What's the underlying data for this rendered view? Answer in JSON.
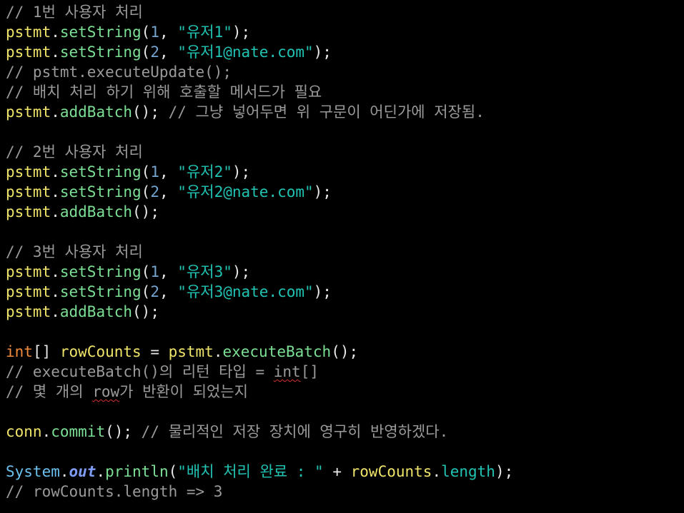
{
  "lines": [
    [
      {
        "t": "// 1번 사용자 처리",
        "c": "cm"
      }
    ],
    [
      {
        "t": "pstmt",
        "c": "var"
      },
      {
        "t": ".",
        "c": "pun"
      },
      {
        "t": "setString",
        "c": "fn"
      },
      {
        "t": "(",
        "c": "pun"
      },
      {
        "t": "1",
        "c": "num"
      },
      {
        "t": ", ",
        "c": "pun"
      },
      {
        "t": "\"유저1\"",
        "c": "str"
      },
      {
        "t": ");",
        "c": "pun"
      }
    ],
    [
      {
        "t": "pstmt",
        "c": "var"
      },
      {
        "t": ".",
        "c": "pun"
      },
      {
        "t": "setString",
        "c": "fn"
      },
      {
        "t": "(",
        "c": "pun"
      },
      {
        "t": "2",
        "c": "num"
      },
      {
        "t": ", ",
        "c": "pun"
      },
      {
        "t": "\"유저1@nate.com\"",
        "c": "str"
      },
      {
        "t": ");",
        "c": "pun"
      }
    ],
    [
      {
        "t": "// pstmt.executeUpdate();",
        "c": "cm"
      }
    ],
    [
      {
        "t": "// 배치 처리 하기 위해 호출할 메서드가 필요",
        "c": "cm"
      }
    ],
    [
      {
        "t": "pstmt",
        "c": "var"
      },
      {
        "t": ".",
        "c": "pun"
      },
      {
        "t": "addBatch",
        "c": "fn"
      },
      {
        "t": "(); ",
        "c": "pun"
      },
      {
        "t": "// 그냥 넣어두면 위 구문이 어딘가에 저장됨.",
        "c": "cm"
      }
    ],
    [],
    [
      {
        "t": "// 2번 사용자 처리",
        "c": "cm"
      }
    ],
    [
      {
        "t": "pstmt",
        "c": "var"
      },
      {
        "t": ".",
        "c": "pun"
      },
      {
        "t": "setString",
        "c": "fn"
      },
      {
        "t": "(",
        "c": "pun"
      },
      {
        "t": "1",
        "c": "num"
      },
      {
        "t": ", ",
        "c": "pun"
      },
      {
        "t": "\"유저2\"",
        "c": "str"
      },
      {
        "t": ");",
        "c": "pun"
      }
    ],
    [
      {
        "t": "pstmt",
        "c": "var"
      },
      {
        "t": ".",
        "c": "pun"
      },
      {
        "t": "setString",
        "c": "fn"
      },
      {
        "t": "(",
        "c": "pun"
      },
      {
        "t": "2",
        "c": "num"
      },
      {
        "t": ", ",
        "c": "pun"
      },
      {
        "t": "\"유저2@nate.com\"",
        "c": "str"
      },
      {
        "t": ");",
        "c": "pun"
      }
    ],
    [
      {
        "t": "pstmt",
        "c": "var"
      },
      {
        "t": ".",
        "c": "pun"
      },
      {
        "t": "addBatch",
        "c": "fn"
      },
      {
        "t": "();",
        "c": "pun"
      }
    ],
    [],
    [
      {
        "t": "// 3번 사용자 처리",
        "c": "cm"
      }
    ],
    [
      {
        "t": "pstmt",
        "c": "var"
      },
      {
        "t": ".",
        "c": "pun"
      },
      {
        "t": "setString",
        "c": "fn"
      },
      {
        "t": "(",
        "c": "pun"
      },
      {
        "t": "1",
        "c": "num"
      },
      {
        "t": ", ",
        "c": "pun"
      },
      {
        "t": "\"유저3\"",
        "c": "str"
      },
      {
        "t": ");",
        "c": "pun"
      }
    ],
    [
      {
        "t": "pstmt",
        "c": "var"
      },
      {
        "t": ".",
        "c": "pun"
      },
      {
        "t": "setString",
        "c": "fn"
      },
      {
        "t": "(",
        "c": "pun"
      },
      {
        "t": "2",
        "c": "num"
      },
      {
        "t": ", ",
        "c": "pun"
      },
      {
        "t": "\"유저3@nate.com\"",
        "c": "str"
      },
      {
        "t": ");",
        "c": "pun"
      }
    ],
    [
      {
        "t": "pstmt",
        "c": "var"
      },
      {
        "t": ".",
        "c": "pun"
      },
      {
        "t": "addBatch",
        "c": "fn"
      },
      {
        "t": "();",
        "c": "pun"
      }
    ],
    [],
    [
      {
        "t": "int",
        "c": "kw"
      },
      {
        "t": "[] ",
        "c": "pun"
      },
      {
        "t": "rowCounts",
        "c": "var"
      },
      {
        "t": " = ",
        "c": "op"
      },
      {
        "t": "pstmt",
        "c": "var"
      },
      {
        "t": ".",
        "c": "pun"
      },
      {
        "t": "executeBatch",
        "c": "fn"
      },
      {
        "t": "();",
        "c": "pun"
      }
    ],
    [
      {
        "t": "// executeBatch()의 리턴 타입 = ",
        "c": "cm"
      },
      {
        "t": "int",
        "c": "cm",
        "sq": true
      },
      {
        "t": "[]",
        "c": "cm"
      }
    ],
    [
      {
        "t": "// 몇 개의 ",
        "c": "cm"
      },
      {
        "t": "row",
        "c": "cm",
        "sq": true
      },
      {
        "t": "가 반환이 되었는지",
        "c": "cm"
      }
    ],
    [],
    [
      {
        "t": "conn",
        "c": "var"
      },
      {
        "t": ".",
        "c": "pun"
      },
      {
        "t": "commit",
        "c": "fn"
      },
      {
        "t": "(); ",
        "c": "pun"
      },
      {
        "t": "// 물리적인 저장 장치에 영구히 반영하겠다.",
        "c": "cm"
      }
    ],
    [],
    [
      {
        "t": "System",
        "c": "cls"
      },
      {
        "t": ".",
        "c": "pun"
      },
      {
        "t": "out",
        "c": "fld"
      },
      {
        "t": ".",
        "c": "pun"
      },
      {
        "t": "println",
        "c": "fn"
      },
      {
        "t": "(",
        "c": "pun"
      },
      {
        "t": "\"배치 처리 완료 : \"",
        "c": "str"
      },
      {
        "t": " + ",
        "c": "op"
      },
      {
        "t": "rowCounts",
        "c": "var"
      },
      {
        "t": ".",
        "c": "pun"
      },
      {
        "t": "length",
        "c": "prop"
      },
      {
        "t": ");",
        "c": "pun"
      }
    ],
    [
      {
        "t": "// rowCounts.length => 3",
        "c": "cm"
      }
    ]
  ]
}
